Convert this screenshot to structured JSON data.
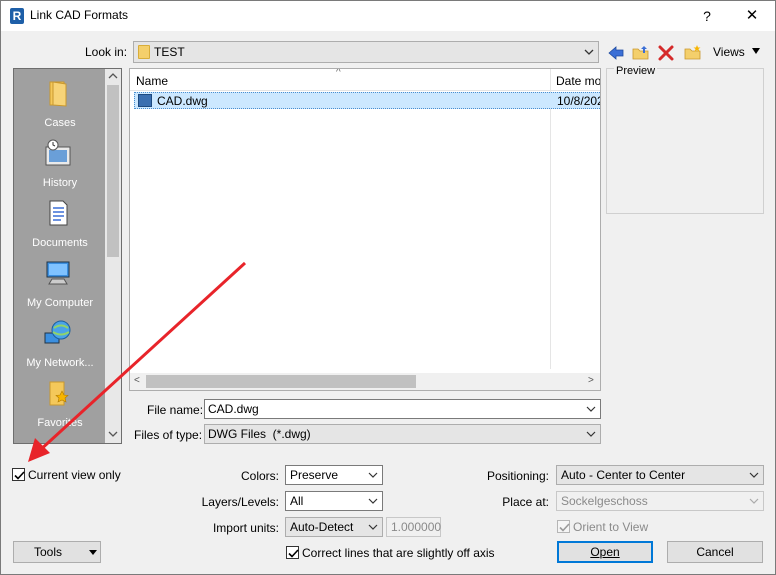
{
  "window": {
    "title": "Link CAD Formats",
    "app_icon_letter": "R",
    "help_glyph": "?",
    "close_glyph": "✕"
  },
  "lookin": {
    "label": "Look in:",
    "value": "TEST",
    "toolbar_icons": [
      "back-arrow-icon",
      "up-folder-icon",
      "delete-icon",
      "new-folder-icon"
    ],
    "views_label": "Views"
  },
  "places": [
    {
      "label": "Cases",
      "icon": "folder-icon"
    },
    {
      "label": "History",
      "icon": "history-icon"
    },
    {
      "label": "Documents",
      "icon": "documents-icon"
    },
    {
      "label": "My Computer",
      "icon": "computer-icon"
    },
    {
      "label": "My Network...",
      "icon": "network-icon"
    },
    {
      "label": "Favorites",
      "icon": "favorites-icon"
    }
  ],
  "filelist": {
    "columns": {
      "name": "Name",
      "date": "Date mo"
    },
    "files": [
      {
        "name": "CAD.dwg",
        "date": "10/8/202"
      }
    ]
  },
  "preview": {
    "label": "Preview"
  },
  "filename": {
    "label": "File name:",
    "value": "CAD.dwg"
  },
  "filetype": {
    "label": "Files of type:",
    "value": "DWG Files  (*.dwg)"
  },
  "options": {
    "current_view_only": {
      "label": "Current view only",
      "checked": true
    },
    "colors": {
      "label": "Colors:",
      "value": "Preserve"
    },
    "layers": {
      "label": "Layers/Levels:",
      "value": "All"
    },
    "import_units": {
      "label": "Import units:",
      "value": "Auto-Detect",
      "scale": "1.000000"
    },
    "correct_lines": {
      "label": "Correct lines that are slightly off axis",
      "checked": true
    },
    "positioning": {
      "label": "Positioning:",
      "value": "Auto - Center to Center"
    },
    "place_at": {
      "label": "Place at:",
      "value": "Sockelgeschoss"
    },
    "orient_to_view": {
      "label": "Orient to View",
      "checked": true
    }
  },
  "buttons": {
    "tools": "Tools",
    "open": "Open",
    "cancel": "Cancel"
  },
  "colors": {
    "annotation_arrow": "#e8242a",
    "selection": "#cce8ff",
    "places_bg": "#a0a0a0"
  }
}
